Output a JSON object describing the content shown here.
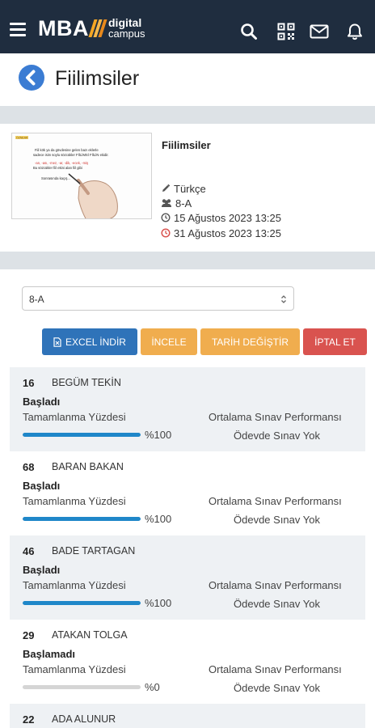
{
  "brand": {
    "name": "MBA",
    "sub_line1": "digital",
    "sub_line2": "campus"
  },
  "page": {
    "title": "Fiilimsiler"
  },
  "homework": {
    "title": "Fiilimsiler",
    "subject": "Türkçe",
    "class_group": "8-A",
    "start_date": "15 Ağustos 2023 13:25",
    "end_date": "31 Ağustos 2023 13:25",
    "thumbnail": {
      "tag": "ÖZNEAR",
      "line1": "Fiil kök ya da gövdesine gelen bazı eklerle",
      "line2": "sadece isim soylu sözcükler FİİLİMSİ FİİLİN ekidir.",
      "line3": "-an, -ası, -mez, -ar, -dik, -ecek, -miş",
      "line4": "Bu sözcükler fiil ekini alan fiil gibi",
      "line5": "Sonrasında kaçış..."
    }
  },
  "class_select": {
    "value": "8-A"
  },
  "actions": {
    "excel": "EXCEL İNDİR",
    "inspect": "İNCELE",
    "change_date": "TARİH DEĞİŞTİR",
    "cancel": "İPTAL ET"
  },
  "students": [
    {
      "number": "16",
      "name": "BEGÜM TEKİN",
      "status": "Başladı",
      "completion_label": "Tamamlanma Yüzdesi",
      "completion": 100,
      "completion_text": "%100",
      "performance_label": "Ortalama Sınav Performansı",
      "exam_text": "Ödevde Sınav Yok"
    },
    {
      "number": "68",
      "name": "BARAN BAKAN",
      "status": "Başladı",
      "completion_label": "Tamamlanma Yüzdesi",
      "completion": 100,
      "completion_text": "%100",
      "performance_label": "Ortalama Sınav Performansı",
      "exam_text": "Ödevde Sınav Yok"
    },
    {
      "number": "46",
      "name": "BADE TARTAGAN",
      "status": "Başladı",
      "completion_label": "Tamamlanma Yüzdesi",
      "completion": 100,
      "completion_text": "%100",
      "performance_label": "Ortalama Sınav Performansı",
      "exam_text": "Ödevde Sınav Yok"
    },
    {
      "number": "29",
      "name": "ATAKAN TOLGA",
      "status": "Başlamadı",
      "completion_label": "Tamamlanma Yüzdesi",
      "completion": 0,
      "completion_text": "%0",
      "performance_label": "Ortalama Sınav Performansı",
      "exam_text": "Ödevde Sınav Yok"
    },
    {
      "number": "22",
      "name": "ADA ALUNUR",
      "status": "",
      "completion_label": "",
      "completion": null,
      "completion_text": "",
      "performance_label": "",
      "exam_text": ""
    }
  ],
  "colors": {
    "topbar": "#1f2d3f",
    "accent_blue": "#3b7cd3",
    "progress_fill": "#1f87c9",
    "excel_button": "#2f73b9",
    "warning_button": "#f0ad4e",
    "danger_button": "#d9534f",
    "end_date_icon": "#d9534f"
  },
  "icons": {
    "menu": "hamburger-menu-icon",
    "search": "search-icon",
    "qr": "qr-code-icon",
    "mail": "mail-icon",
    "bell": "bell-icon",
    "back": "back-arrow-icon",
    "subject": "pencil-icon",
    "class": "group-icon",
    "start": "clock-icon",
    "end": "clock-alert-icon",
    "excel": "file-excel-icon"
  }
}
